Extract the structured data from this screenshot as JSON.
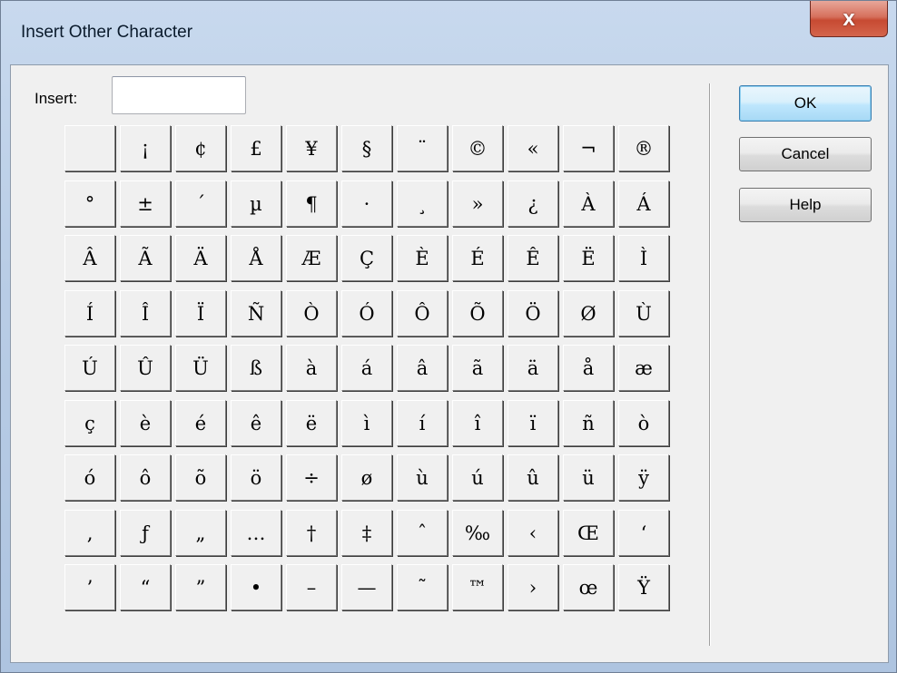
{
  "window": {
    "title": "Insert Other Character",
    "close_glyph": "x"
  },
  "insert": {
    "label": "Insert:",
    "value": ""
  },
  "buttons": {
    "ok": "OK",
    "cancel": "Cancel",
    "help": "Help"
  },
  "characters": [
    [
      " ",
      "¡",
      "¢",
      "£",
      "¥",
      "§",
      "¨",
      "©",
      "«",
      "¬",
      "®"
    ],
    [
      "°",
      "±",
      "´",
      "µ",
      "¶",
      "·",
      "¸",
      "»",
      "¿",
      "À",
      "Á"
    ],
    [
      "Â",
      "Ã",
      "Ä",
      "Å",
      "Æ",
      "Ç",
      "È",
      "É",
      "Ê",
      "Ë",
      "Ì"
    ],
    [
      "Í",
      "Î",
      "Ï",
      "Ñ",
      "Ò",
      "Ó",
      "Ô",
      "Õ",
      "Ö",
      "Ø",
      "Ù"
    ],
    [
      "Ú",
      "Û",
      "Ü",
      "ß",
      "à",
      "á",
      "â",
      "ã",
      "ä",
      "å",
      "æ"
    ],
    [
      "ç",
      "è",
      "é",
      "ê",
      "ë",
      "ì",
      "í",
      "î",
      "ï",
      "ñ",
      "ò"
    ],
    [
      "ó",
      "ô",
      "õ",
      "ö",
      "÷",
      "ø",
      "ù",
      "ú",
      "û",
      "ü",
      "ÿ"
    ],
    [
      "‚",
      "ƒ",
      "„",
      "…",
      "†",
      "‡",
      "ˆ",
      "‰",
      "‹",
      "Œ",
      "‘"
    ],
    [
      "’",
      "“",
      "”",
      "•",
      "–",
      "—",
      "˜",
      "™",
      "›",
      "œ",
      "Ÿ"
    ]
  ]
}
